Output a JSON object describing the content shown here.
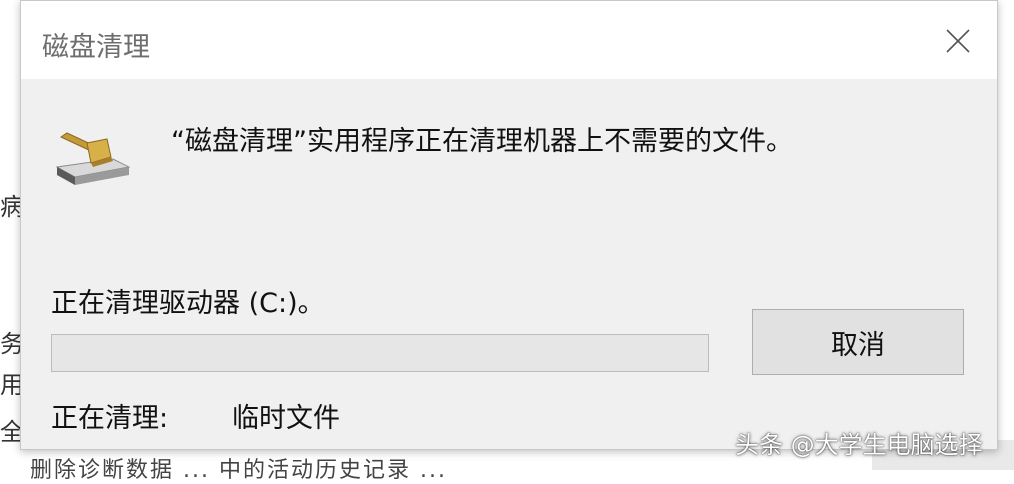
{
  "background": {
    "glyphs": [
      "病",
      "务",
      "用",
      "全"
    ],
    "bottom_text": "删除诊断数据   ...   中的活动历史记录 ..."
  },
  "dialog": {
    "title": "磁盘清理",
    "message": "“磁盘清理”实用程序正在清理机器上不需要的文件。",
    "drive_label": "正在清理驱动器 (C:)。",
    "progress_fraction": 0.0,
    "cancel_label": "取消",
    "status_label": "正在清理:",
    "status_value": "临时文件"
  },
  "watermark": "头条 @大学生电脑选择",
  "colors": {
    "progress_fill": "#06b025",
    "dialog_bg": "#f0f0f0",
    "title_text": "#6d6d6d"
  },
  "icons": [
    "disk-cleanup-icon",
    "close-icon"
  ]
}
